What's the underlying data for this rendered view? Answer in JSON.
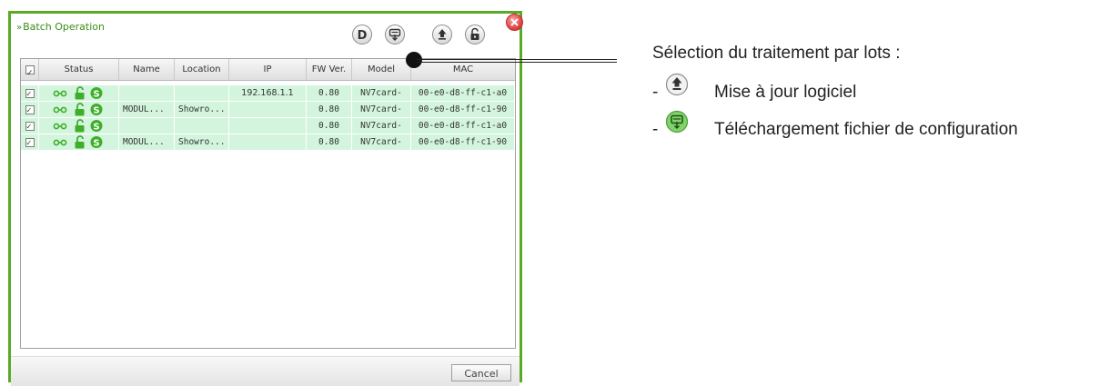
{
  "dialog": {
    "title": "Batch Operation",
    "title_prefix": "»",
    "cancel_label": "Cancel",
    "toolbar_d_label": "D"
  },
  "table": {
    "columns": [
      "Status",
      "Name",
      "Location",
      "IP",
      "FW Ver.",
      "Model",
      "MAC"
    ],
    "rows": [
      {
        "name": "",
        "location": "",
        "ip": "192.168.1.1",
        "fw": "0.80",
        "model": "NV7card-",
        "mac": "00-e0-d8-ff-c1-a0"
      },
      {
        "name": "MODUL...",
        "location": "Showro...",
        "ip": "",
        "fw": "0.80",
        "model": "NV7card-",
        "mac": "00-e0-d8-ff-c1-90"
      },
      {
        "name": "",
        "location": "",
        "ip": "",
        "fw": "0.80",
        "model": "NV7card-",
        "mac": "00-e0-d8-ff-c1-a0"
      },
      {
        "name": "MODUL...",
        "location": "Showro...",
        "ip": "",
        "fw": "0.80",
        "model": "NV7card-",
        "mac": "00-e0-d8-ff-c1-90"
      }
    ]
  },
  "annotation": {
    "heading": "Sélection du traitement par lots :",
    "items": [
      {
        "dash": "-",
        "icon": "upload-icon",
        "label": "Mise à jour logiciel"
      },
      {
        "dash": "-",
        "icon": "config-download-icon",
        "label": "Téléchargement fichier de configuration"
      }
    ]
  },
  "colors": {
    "frame_green": "#5aaa28",
    "row_green": "#d3f5dd",
    "icon_green": "#3fae2a",
    "close_red": "#e04848"
  }
}
